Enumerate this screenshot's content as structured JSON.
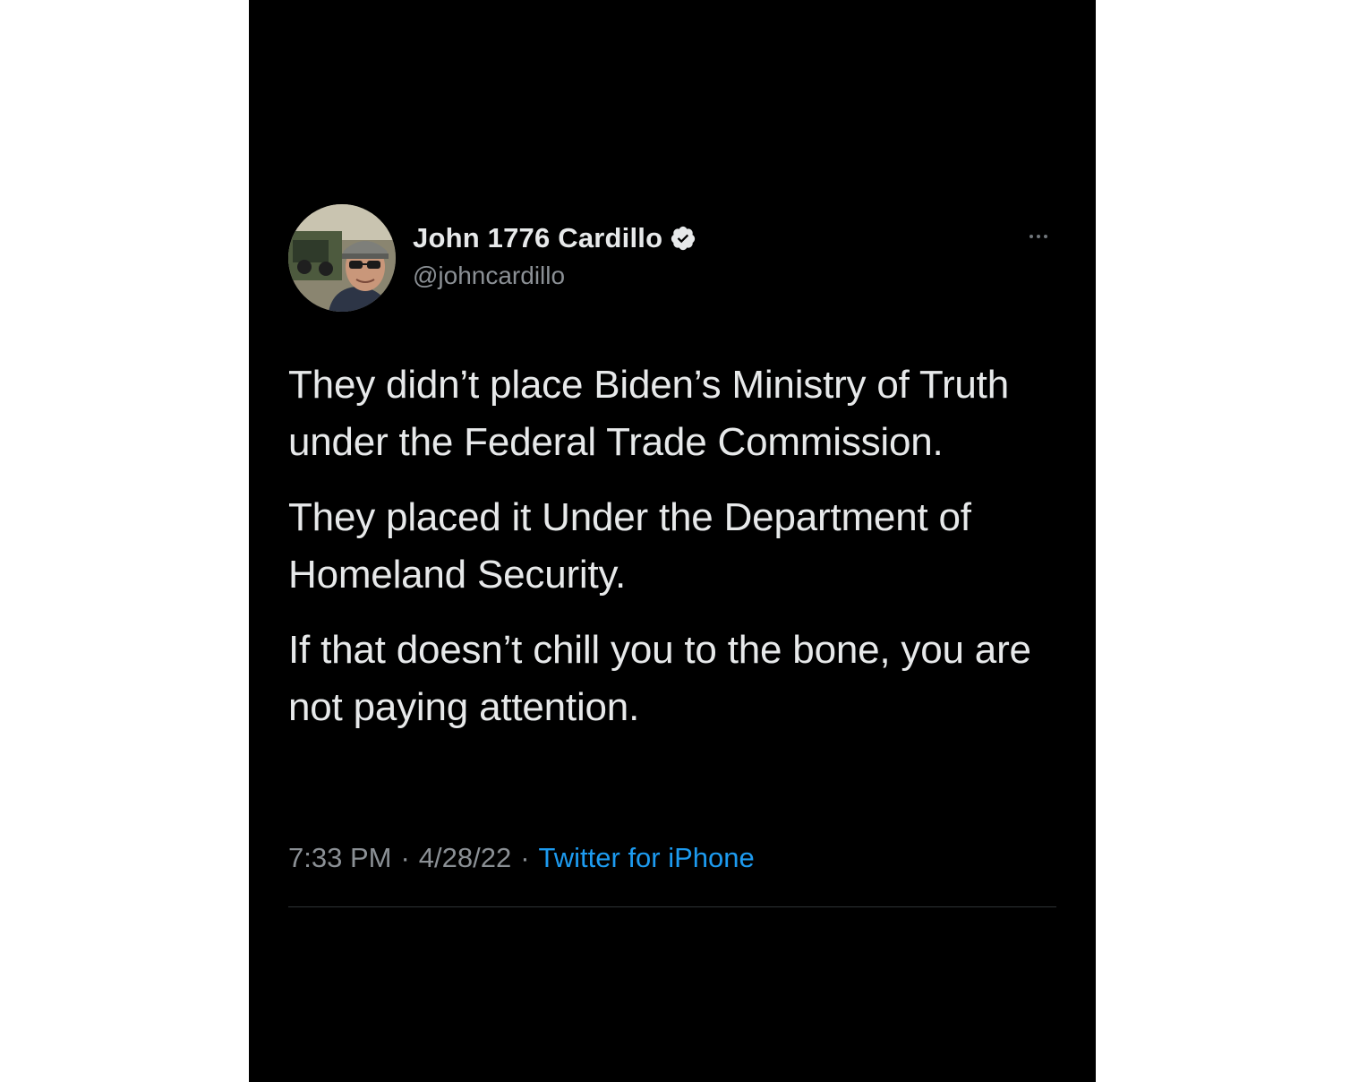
{
  "tweet": {
    "author": {
      "display_name": "John 1776 Cardillo",
      "handle": "@johncardillo",
      "verified": true
    },
    "paragraphs": [
      "They didn’t place Biden’s Ministry of Truth under the Federal Trade Commission.",
      "They placed it Under the Department of Homeland Security.",
      "If that doesn’t chill you to the bone, you are not paying attention."
    ],
    "time": "7:33 PM",
    "separator": "·",
    "date": "4/28/22",
    "source": "Twitter for iPhone"
  },
  "icons": {
    "verified_badge": "verified-badge-icon",
    "more_options": "more-options-icon"
  },
  "colors": {
    "background": "#000000",
    "text_primary": "#e7e9ea",
    "text_secondary": "#8b9095",
    "link": "#1d9bf0",
    "divider": "#2f3336"
  }
}
